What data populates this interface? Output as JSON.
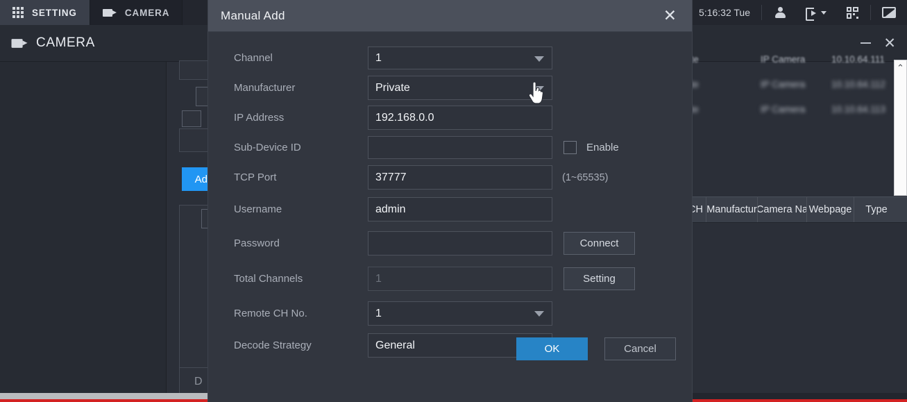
{
  "topbar": {
    "tabs": [
      {
        "label": "SETTING",
        "icon": "grid-icon",
        "state": "active"
      },
      {
        "label": "CAMERA",
        "icon": "camera-icon",
        "state": "dark"
      }
    ],
    "clock": "5:16:32 Tue",
    "icons": [
      "user-icon",
      "logout-icon",
      "qr-code-icon",
      "monitor-icon"
    ]
  },
  "window": {
    "title": "CAMERA",
    "minimize_label": "–",
    "close_label": "✕"
  },
  "background": {
    "add_button": "Add",
    "delete_button": "D",
    "table_headers": [
      "CH",
      "Manufactur",
      "Camera Na",
      "Webpage",
      "Type"
    ],
    "rows": [
      {
        "status": "ate",
        "camera": "IP Camera",
        "address": "10.10.64.111"
      },
      {
        "status": "ate",
        "camera": "IP Camera",
        "address": "10.10.64.112"
      },
      {
        "status": "ate",
        "camera": "IP Camera",
        "address": "10.10.64.113"
      }
    ],
    "scroll_arrow": "⌃"
  },
  "dialog": {
    "title": "Manual Add",
    "close_icon": "✕",
    "fields": [
      {
        "label": "Channel",
        "value": "1",
        "type": "select"
      },
      {
        "label": "Manufacturer",
        "value": "Private",
        "type": "select"
      },
      {
        "label": "IP Address",
        "value": "192.168.0.0",
        "type": "input"
      },
      {
        "label": "Sub-Device ID",
        "value": "",
        "type": "input"
      },
      {
        "label": "TCP Port",
        "value": "37777",
        "type": "input"
      },
      {
        "label": "Username",
        "value": "admin",
        "type": "input"
      },
      {
        "label": "Password",
        "value": "",
        "type": "input"
      },
      {
        "label": "Total Channels",
        "value": "1",
        "type": "input-disabled"
      },
      {
        "label": "Remote CH No.",
        "value": "1",
        "type": "select"
      },
      {
        "label": "Decode Strategy",
        "value": "General",
        "type": "select"
      }
    ],
    "enable_checkbox_label": "Enable",
    "tcp_port_hint": "(1~65535)",
    "connect_button": "Connect",
    "setting_button": "Setting",
    "ok_button": "OK",
    "cancel_button": "Cancel"
  },
  "colors": {
    "accent_blue": "#2784c6",
    "add_blue": "#2196f3",
    "dialog_bg": "#32363f",
    "dialog_title_bg": "#4b505b",
    "app_bg": "#2b2f38",
    "alert_red": "#d32222"
  }
}
